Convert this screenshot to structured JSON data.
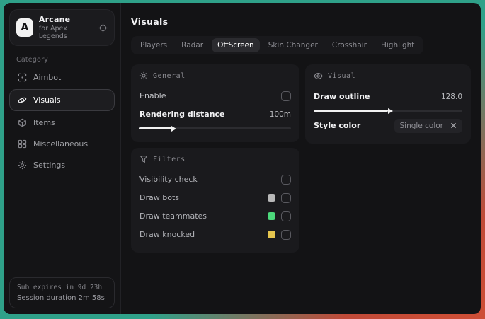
{
  "brand": {
    "logo_letter": "A",
    "title": "Arcane",
    "subtitle": "for Apex Legends"
  },
  "sidebar": {
    "category_label": "Category",
    "items": [
      {
        "label": "Aimbot"
      },
      {
        "label": "Visuals"
      },
      {
        "label": "Items"
      },
      {
        "label": "Miscellaneous"
      },
      {
        "label": "Settings"
      }
    ],
    "footer": {
      "line1": "Sub expires in 9d 23h",
      "line2": "Session duration 2m 58s"
    }
  },
  "main": {
    "title": "Visuals",
    "tabs": [
      {
        "label": "Players"
      },
      {
        "label": "Radar"
      },
      {
        "label": "OffScreen",
        "selected": true
      },
      {
        "label": "Skin Changer"
      },
      {
        "label": "Crosshair"
      },
      {
        "label": "Highlight"
      }
    ],
    "panels": {
      "general": {
        "title": "General",
        "enable_label": "Enable",
        "rendering_distance_label": "Rendering distance",
        "rendering_distance_value": "100m",
        "rendering_distance_percent": 21
      },
      "visual": {
        "title": "Visual",
        "draw_outline_label": "Draw outline",
        "draw_outline_value": "128.0",
        "draw_outline_percent": 50,
        "style_color_label": "Style color",
        "style_color_value": "Single color"
      },
      "filters": {
        "title": "Filters",
        "rows": [
          {
            "label": "Visibility check",
            "swatch": null
          },
          {
            "label": "Draw bots",
            "swatch": "#b8b8b8"
          },
          {
            "label": "Draw teammates",
            "swatch": "#4cd97b"
          },
          {
            "label": "Draw knocked",
            "swatch": "#e5c54e"
          }
        ]
      }
    }
  },
  "colors": {
    "accent_teal": "#2fa189",
    "accent_red": "#c04a38",
    "panel_bg": "#1a1a1d"
  }
}
